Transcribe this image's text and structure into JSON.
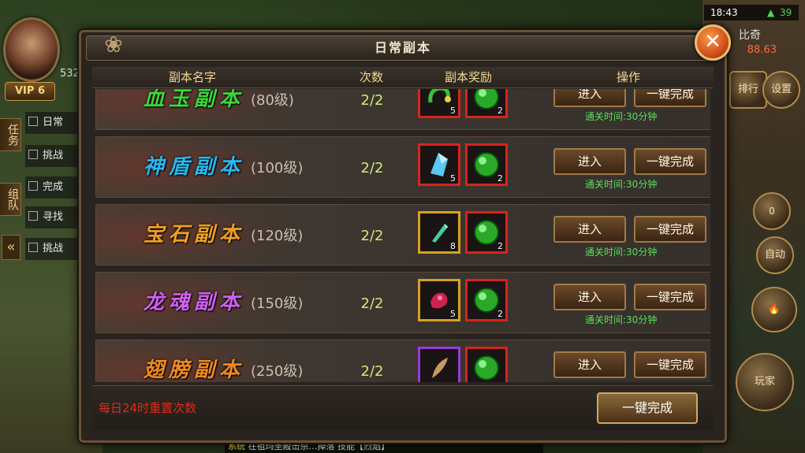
{
  "hud": {
    "player_level": "532",
    "vip": "VIP 6",
    "tab_task": "任务",
    "tab_team": "组队",
    "collapse": "«",
    "quests": [
      "日常",
      "挑战",
      "完成",
      "寻找",
      "挑战"
    ],
    "status_time": "18:43",
    "battery": "39",
    "rank_title": "比奇",
    "rank_score": "88.63",
    "ranking_label": "排行",
    "settings_label": "设置",
    "auto_label": "自动",
    "counter_value": "0",
    "play_label": "玩家",
    "chat_channel": "系统",
    "chat_text": "在祖玛圣殿击杀…掉落 技能【烈焰】"
  },
  "dialog": {
    "title": "日常副本",
    "headers": {
      "name": "副本名字",
      "count": "次数",
      "reward": "副本奖励",
      "action": "操作"
    },
    "rows": [
      {
        "name": "血玉副本",
        "level": "(80级)",
        "count": "2/2",
        "reward1_qty": "5",
        "reward2_qty": "2",
        "enter": "进入",
        "oneclick": "一键完成",
        "clear_time": "通关时间:30分钟"
      },
      {
        "name": "神盾副本",
        "level": "(100级)",
        "count": "2/2",
        "reward1_qty": "5",
        "reward2_qty": "2",
        "enter": "进入",
        "oneclick": "一键完成",
        "clear_time": "通关时间:30分钟"
      },
      {
        "name": "宝石副本",
        "level": "(120级)",
        "count": "2/2",
        "reward1_qty": "8",
        "reward2_qty": "2",
        "enter": "进入",
        "oneclick": "一键完成",
        "clear_time": "通关时间:30分钟"
      },
      {
        "name": "龙魂副本",
        "level": "(150级)",
        "count": "2/2",
        "reward1_qty": "5",
        "reward2_qty": "2",
        "enter": "进入",
        "oneclick": "一键完成",
        "clear_time": "通关时间:30分钟"
      },
      {
        "name": "翅膀副本",
        "level": "(250级)",
        "count": "2/2",
        "reward1_qty": "",
        "reward2_qty": "",
        "enter": "进入",
        "oneclick": "一键完成",
        "clear_time": ""
      }
    ],
    "reset_note": "每日24时重置次数",
    "complete_all": "一键完成"
  }
}
